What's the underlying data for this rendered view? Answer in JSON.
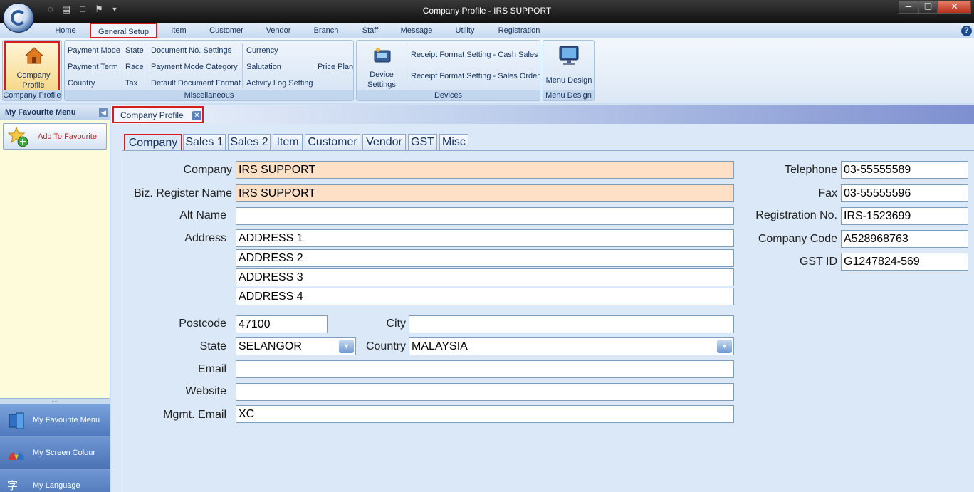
{
  "window": {
    "title": "Company Profile - IRS SUPPORT"
  },
  "menu_tabs": [
    "Home",
    "General Setup",
    "Item",
    "Customer",
    "Vendor",
    "Branch",
    "Staff",
    "Message",
    "Utility",
    "Registration"
  ],
  "ribbon": {
    "company_profile": {
      "label_line1": "Company",
      "label_line2": "Profile",
      "group": "Company Profile"
    },
    "misc": {
      "group": "Miscellaneous",
      "payment_mode": "Payment Mode",
      "payment_term": "Payment Term",
      "country": "Country",
      "state": "State",
      "race": "Race",
      "tax": "Tax",
      "doc_no_settings": "Document No. Settings",
      "payment_mode_category": "Payment Mode Category",
      "default_doc_format": "Default Document Format",
      "currency": "Currency",
      "salutation": "Salutation",
      "activity_log": "Activity Log Setting",
      "price_plan": "Price Plan"
    },
    "devices": {
      "group": "Devices",
      "device_settings_line1": "Device",
      "device_settings_line2": "Settings",
      "receipt_cash": "Receipt Format Setting - Cash  Sales",
      "receipt_sales_order": "Receipt Format Setting - Sales Order"
    },
    "menu_design": {
      "label": "Menu Design",
      "group": "Menu Design"
    }
  },
  "sidebar": {
    "title": "My Favourite Menu",
    "add_favourite": "Add To Favourite",
    "nav": [
      "My Favourite Menu",
      "My Screen Colour",
      "My Language"
    ]
  },
  "doc_tab": {
    "label": "Company Profile"
  },
  "inner_tabs": [
    "Company",
    "Sales 1",
    "Sales 2",
    "Item",
    "Customer",
    "Vendor",
    "GST",
    "Misc"
  ],
  "form": {
    "company": {
      "label": "Company",
      "value": "IRS SUPPORT"
    },
    "biz_register_name": {
      "label": "Biz. Register Name",
      "value": "IRS SUPPORT"
    },
    "alt_name": {
      "label": "Alt Name",
      "value": ""
    },
    "address": {
      "label": "Address",
      "lines": [
        "ADDRESS 1",
        "ADDRESS 2",
        "ADDRESS 3",
        "ADDRESS 4"
      ]
    },
    "postcode": {
      "label": "Postcode",
      "value": "47100"
    },
    "city": {
      "label": "City",
      "value": ""
    },
    "state": {
      "label": "State",
      "value": "SELANGOR"
    },
    "country": {
      "label": "Country",
      "value": "MALAYSIA"
    },
    "email": {
      "label": "Email",
      "value": ""
    },
    "website": {
      "label": "Website",
      "value": ""
    },
    "mgmt_email": {
      "label": "Mgmt. Email",
      "value": "XC"
    },
    "telephone": {
      "label": "Telephone",
      "value": "03-55555589"
    },
    "fax": {
      "label": "Fax",
      "value": "03-55555596"
    },
    "registration_no": {
      "label": "Registration No.",
      "value": "IRS-1523699"
    },
    "company_code": {
      "label": "Company Code",
      "value": "A528968763"
    },
    "gst_id": {
      "label": "GST ID",
      "value": "G1247824-569"
    }
  },
  "colors": {
    "highlight": "#d61c1c",
    "readonly_field": "#fde0c6",
    "nav_blue": "#4f79bd"
  }
}
